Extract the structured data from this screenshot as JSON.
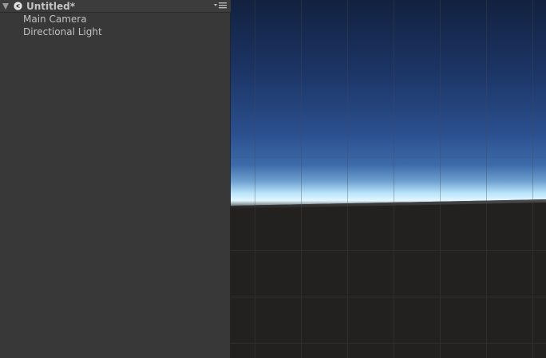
{
  "hierarchy": {
    "scene_name": "Untitled*",
    "items": [
      {
        "label": "Main Camera"
      },
      {
        "label": "Directional Light"
      }
    ],
    "icons": {
      "foldout": "triangle-down-icon",
      "scene": "unity-logo-icon",
      "menu": "dropdown-menu-icon"
    }
  },
  "scene_view": {
    "colors": {
      "sky_top": "#14254a",
      "sky_mid": "#284985",
      "horizon_glow": "#d6f2ff",
      "ground": "#232120",
      "grid": "#3a3a3a"
    }
  }
}
